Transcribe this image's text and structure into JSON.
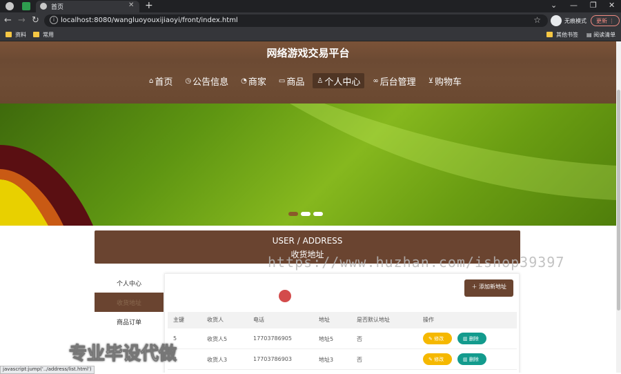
{
  "browser": {
    "tab_title": "首页",
    "url": "localhost:8080/wangluoyouxijiaoyi/front/index.html",
    "incognito_label": "无痕模式",
    "update_label": "更新",
    "bookmarks": [
      "资料",
      "常用"
    ],
    "bookmarks_right": [
      "其他书签",
      "阅读清单"
    ]
  },
  "header": {
    "site_title": "网络游戏交易平台",
    "nav": [
      {
        "label": "首页",
        "icon": "home-icon"
      },
      {
        "label": "公告信息",
        "icon": "clock-icon"
      },
      {
        "label": "商家",
        "icon": "gauge-icon"
      },
      {
        "label": "商品",
        "icon": "book-icon"
      },
      {
        "label": "个人中心",
        "icon": "user-icon"
      },
      {
        "label": "后台管理",
        "icon": "link-icon"
      },
      {
        "label": "购物车",
        "icon": "cart-icon"
      }
    ]
  },
  "section": {
    "title_en": "USER / ADDRESS",
    "title_zh": "收货地址"
  },
  "watermark": "https://www.huzhan.com/ishop39397",
  "side_menu": [
    "个人中心",
    "收货地址",
    "商品订单"
  ],
  "content": {
    "add_button": "添加新地址",
    "columns": [
      "主键",
      "收货人",
      "电话",
      "地址",
      "是否默认地址",
      "操作"
    ],
    "rows": [
      {
        "id": "5",
        "name": "收货人5",
        "phone": "17703786905",
        "address": "地址5",
        "default": "否"
      },
      {
        "id": "3",
        "name": "收货人3",
        "phone": "17703786903",
        "address": "地址3",
        "default": "否"
      }
    ],
    "edit_label": "修改",
    "delete_label": "删除"
  },
  "overlay_text": "专业毕设代做",
  "status_tip": "javascript:jump('../address/list.html')",
  "colors": {
    "brand_brown": "#6a4430",
    "edit_yellow": "#f5b800",
    "delete_teal": "#139b8d"
  }
}
